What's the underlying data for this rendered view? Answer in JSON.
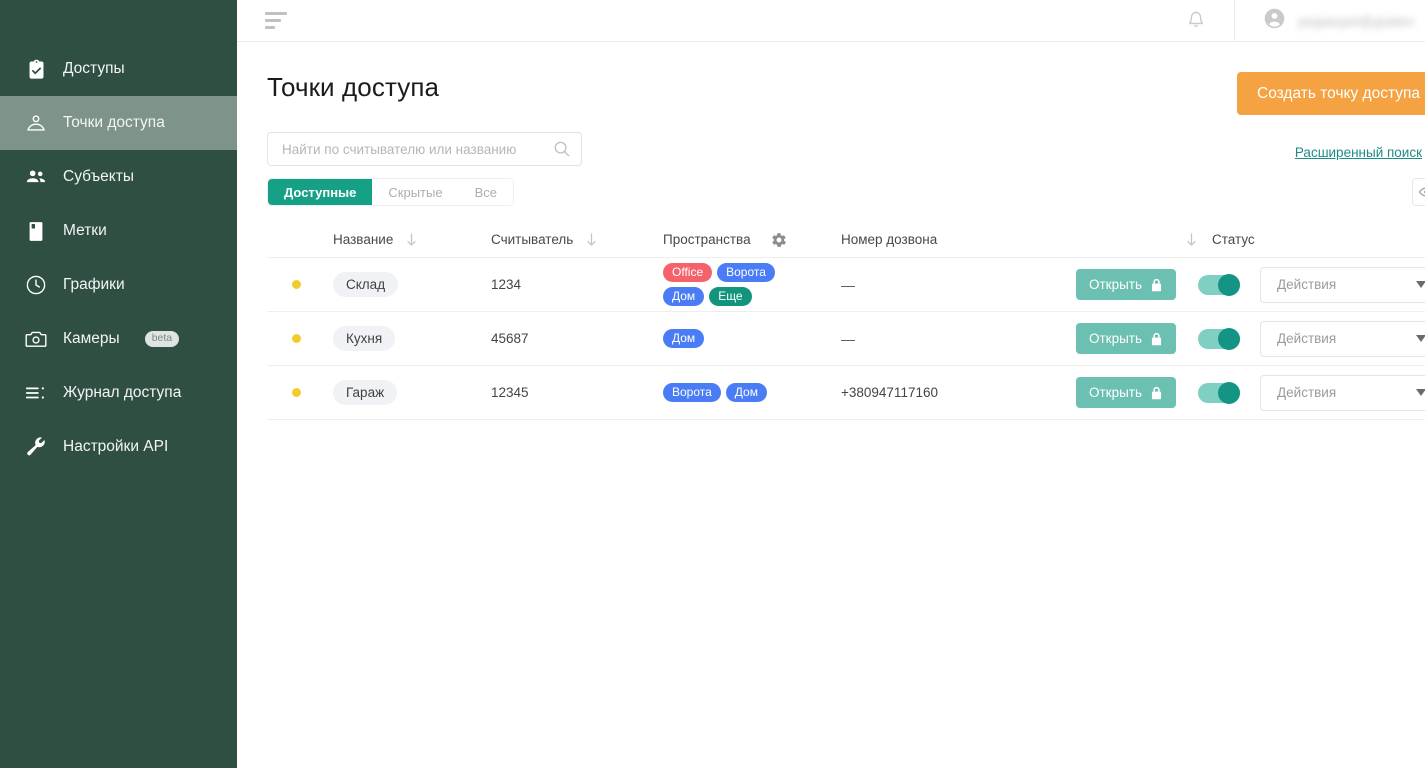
{
  "sidebar": {
    "items": [
      {
        "label": "Доступы",
        "icon": "clipboard-check-icon",
        "active": false
      },
      {
        "label": "Точки доступа",
        "icon": "access-point-icon",
        "active": true
      },
      {
        "label": "Субъекты",
        "icon": "people-icon",
        "active": false
      },
      {
        "label": "Метки",
        "icon": "tag-card-icon",
        "active": false
      },
      {
        "label": "Графики",
        "icon": "clock-icon",
        "active": false
      },
      {
        "label": "Камеры",
        "icon": "camera-icon",
        "active": false,
        "badge": "beta"
      },
      {
        "label": "Журнал доступа",
        "icon": "list-icon",
        "active": false
      },
      {
        "label": "Настройки API",
        "icon": "wrench-icon",
        "active": false
      }
    ]
  },
  "topbar": {
    "menu_icon": "hamburger-icon",
    "bell_icon": "bell-icon",
    "avatar_icon": "user-circle-icon",
    "user_name": "редакция@домен",
    "caret_icon": "chevron-down-icon"
  },
  "header": {
    "title": "Точки доступа",
    "create_button": "Создать точку доступа"
  },
  "search": {
    "placeholder": "Найти по считывателю или названию",
    "value": "",
    "icon": "search-icon",
    "advanced_label": "Расширенный поиск",
    "advanced_caret": "chevron-down-icon"
  },
  "tabs": {
    "items": [
      "Доступные",
      "Скрытые",
      "Все"
    ],
    "active_index": 0,
    "eye_icon": "eye-icon"
  },
  "table": {
    "columns": [
      {
        "label": "",
        "sortable": false
      },
      {
        "label": "Название",
        "sortable": true
      },
      {
        "label": "Считыватель",
        "sortable": true
      },
      {
        "label": "Пространства",
        "sortable": false,
        "gear": true
      },
      {
        "label": "Номер дозвона",
        "sortable": false
      },
      {
        "label": "",
        "sortable": true
      },
      {
        "label": "Статус",
        "sortable": false
      }
    ],
    "open_label": "Открыть",
    "open_icon": "lock-icon",
    "action_placeholder": "Действия",
    "rows": [
      {
        "status_color": "#f2cb2e",
        "name": "Склад",
        "reader": "1234",
        "spaces": [
          {
            "label": "Office",
            "color": "#f4636b"
          },
          {
            "label": "Ворота",
            "color": "#4a7df5"
          },
          {
            "label": "Дом",
            "color": "#4a7df5"
          },
          {
            "label": "Еще",
            "color": "#13957d"
          }
        ],
        "phone": "—",
        "enabled": true
      },
      {
        "status_color": "#f2cb2e",
        "name": "Кухня",
        "reader": "45687",
        "spaces": [
          {
            "label": "Дом",
            "color": "#4a7df5"
          }
        ],
        "phone": "—",
        "enabled": true
      },
      {
        "status_color": "#f2cb2e",
        "name": "Гараж",
        "reader": "12345",
        "spaces": [
          {
            "label": "Ворота",
            "color": "#4a7df5"
          },
          {
            "label": "Дом",
            "color": "#4a7df5"
          }
        ],
        "phone": "+380947117160",
        "enabled": true
      }
    ]
  },
  "colors": {
    "sidebar_bg": "#2f4f43",
    "sidebar_active": "#7e9489",
    "accent_orange": "#f5a342",
    "accent_teal": "#16a085",
    "open_button": "#6cc0b2",
    "link_teal": "#1d8c84"
  }
}
